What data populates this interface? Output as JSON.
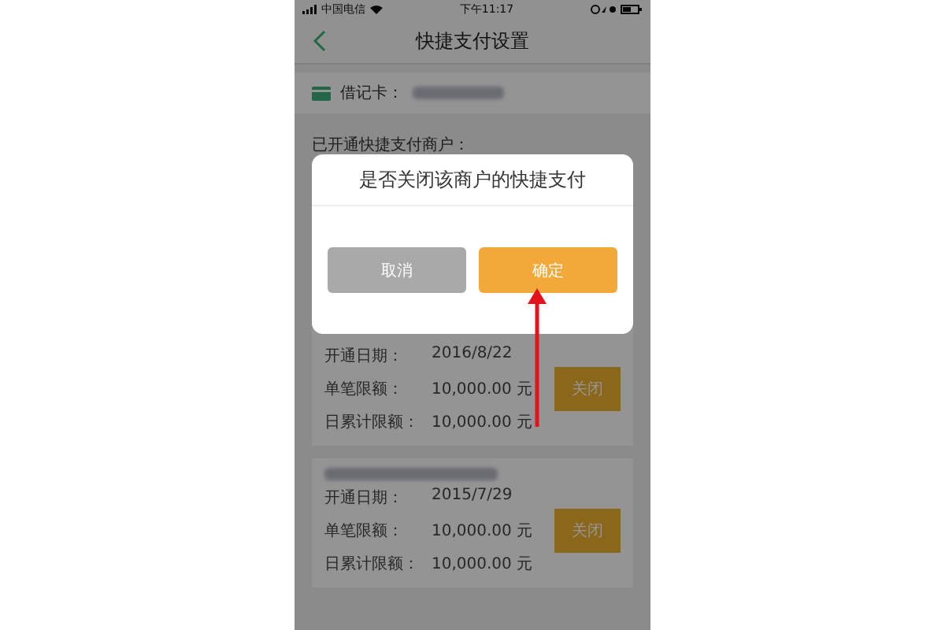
{
  "status_bar": {
    "carrier": "中国电信",
    "time": "下午11:17"
  },
  "nav": {
    "title": "快捷支付设置"
  },
  "card": {
    "label": "借记卡："
  },
  "section_title": "已开通快捷支付商户：",
  "merchants": [
    {
      "name_visible": false,
      "rows": [
        {
          "label": "开通日期：",
          "value": "2016/8/22"
        },
        {
          "label": "单笔限额：",
          "value": "10,000.00 元"
        },
        {
          "label": "日累计限额：",
          "value": "10,000.00 元"
        }
      ],
      "button": "关闭"
    },
    {
      "name_visible": true,
      "rows": [
        {
          "label": "开通日期：",
          "value": "2015/7/29"
        },
        {
          "label": "单笔限额：",
          "value": "10,000.00 元"
        },
        {
          "label": "日累计限额：",
          "value": "10,000.00 元"
        }
      ],
      "button": "关闭"
    }
  ],
  "dialog": {
    "message": "是否关闭该商户的快捷支付",
    "buttons": [
      {
        "label": "取消",
        "kind": "cancel"
      },
      {
        "label": "确定",
        "kind": "confirm"
      }
    ]
  }
}
